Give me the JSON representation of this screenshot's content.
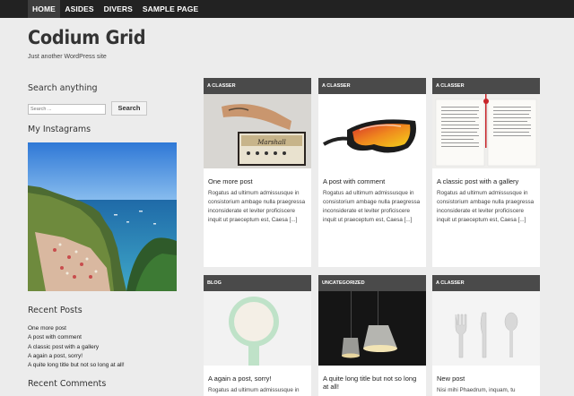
{
  "nav": {
    "items": [
      {
        "label": "HOME",
        "active": true
      },
      {
        "label": "ASIDES",
        "active": false
      },
      {
        "label": "DIVERS",
        "active": false
      },
      {
        "label": "SAMPLE PAGE",
        "active": false
      }
    ]
  },
  "site": {
    "title": "Codium Grid",
    "description": "Just another WordPress site"
  },
  "sidebar": {
    "search": {
      "title": "Search anything",
      "placeholder": "Search ...",
      "button_label": "Search"
    },
    "instagram": {
      "title": "My Instagrams"
    },
    "recent_posts": {
      "title": "Recent Posts",
      "items": [
        "One more post",
        "A post with comment",
        "A classic post with a gallery",
        "A again a post, sorry!",
        "A quite long title but not so long at all!"
      ]
    },
    "recent_comments": {
      "title": "Recent Comments"
    }
  },
  "posts": [
    {
      "category": "A CLASSER",
      "title": "One more post",
      "excerpt": "Rogatus ad ultimum admissusque in consistorium ambage nulla praegressa inconsiderate et leviter proficiscere inquit ut praeceptum est, Caesa [...]",
      "thumb": "speaker"
    },
    {
      "category": "A CLASSER",
      "title": "A post with comment",
      "excerpt": "Rogatus ad ultimum admissusque in consistorium ambage nulla praegressa inconsiderate et leviter proficiscere inquit ut praeceptum est, Caesa [...]",
      "thumb": "goggles"
    },
    {
      "category": "A CLASSER",
      "title": "A classic post with a gallery",
      "excerpt": "Rogatus ad ultimum admissusque in consistorium ambage nulla praegressa inconsiderate et leviter proficiscere inquit ut praeceptum est, Caesa [...]",
      "thumb": "book"
    },
    {
      "category": "BLOG",
      "title": "A again a post, sorry!",
      "excerpt": "Rogatus ad ultimum admissusque in",
      "thumb": "mirror"
    },
    {
      "category": "UNCATEGORIZED",
      "title": "A quite long title but not so long at all!",
      "excerpt": "",
      "thumb": "lamps"
    },
    {
      "category": "A CLASSER",
      "title": "New post",
      "excerpt": "Nisi mihi Phaedrum, inquam, tu",
      "thumb": "cutlery"
    }
  ],
  "colors": {
    "nav_bg": "#222222",
    "nav_active": "#3d3d3d",
    "category_bar": "#4a4a4a",
    "page_bg": "#ececec"
  }
}
